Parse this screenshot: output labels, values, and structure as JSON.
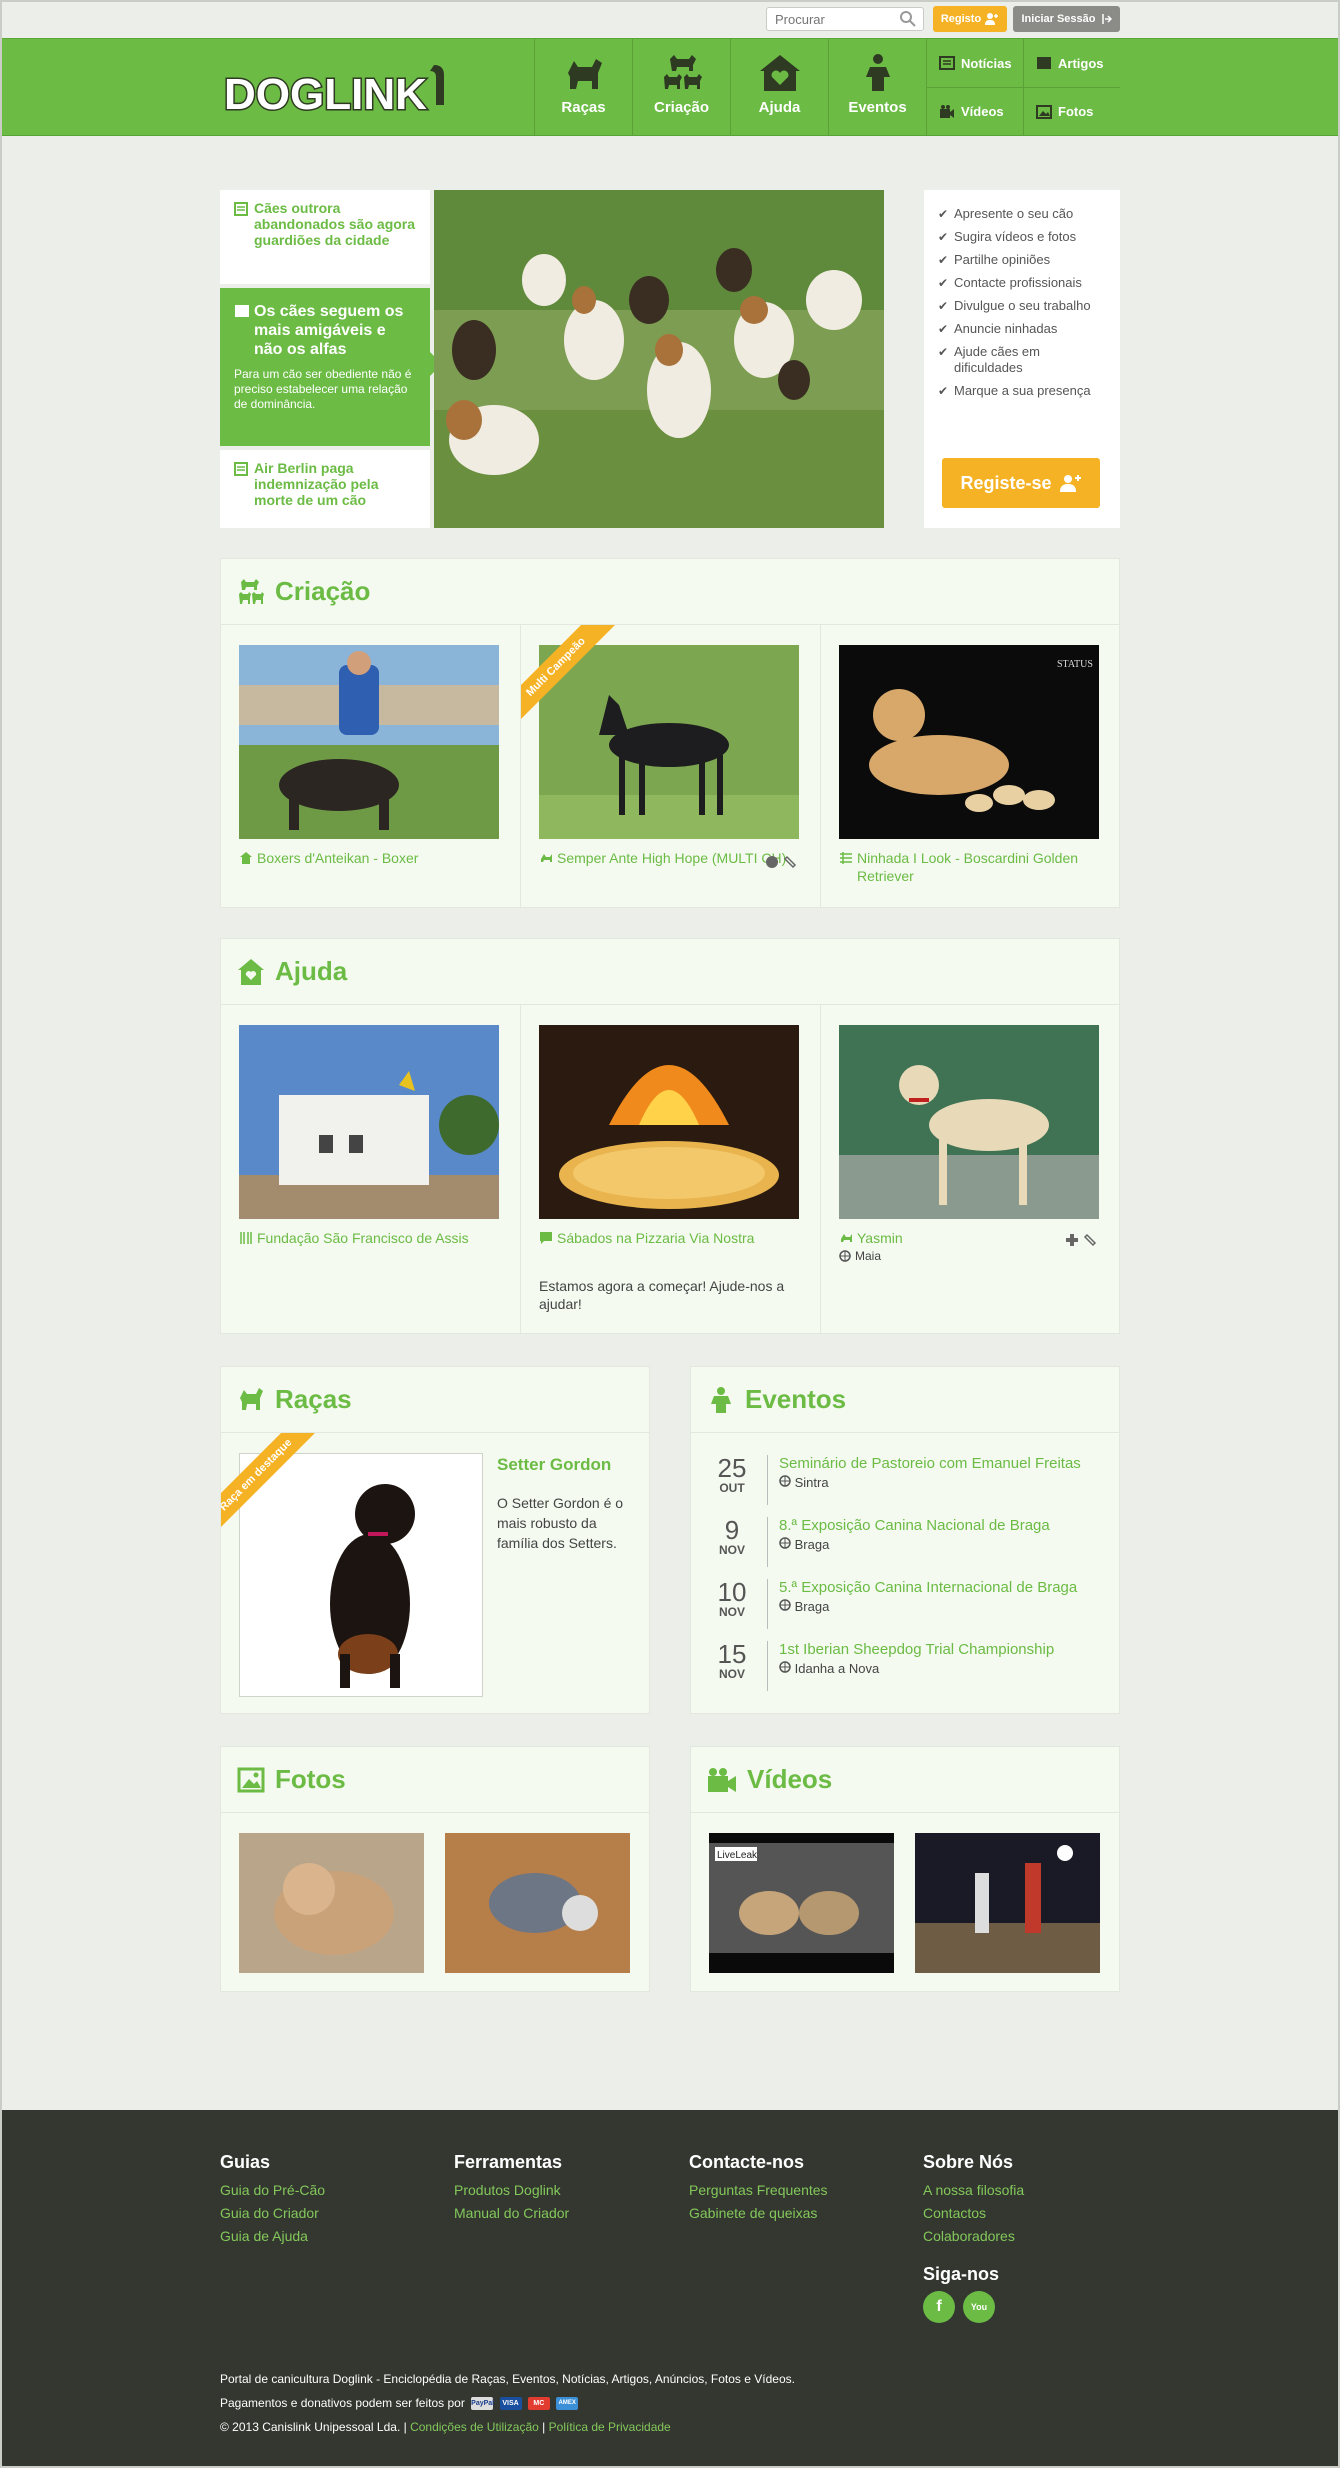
{
  "top": {
    "search_placeholder": "Procurar",
    "register_label": "Registo",
    "login_label": "Iniciar Sessão"
  },
  "brand": {
    "logo_text": "DOGLINK",
    "green": "#6bbb44",
    "yellow": "#f6b225"
  },
  "nav": {
    "big": [
      "Raças",
      "Criação",
      "Ajuda",
      "Eventos"
    ],
    "small": [
      "Notícias",
      "Artigos",
      "Vídeos",
      "Fotos"
    ]
  },
  "news": [
    {
      "title": "Cães outrora abandonados são agora guardiões da cidade"
    },
    {
      "title": "Os cães seguem os mais amigáveis e não os alfas",
      "text": "Para um cão ser obediente não é preciso estabelecer uma relação de dominância."
    },
    {
      "title": "Air Berlin paga indemnização pela morte de um cão"
    }
  ],
  "side": {
    "items": [
      "Apresente o seu cão",
      "Sugira vídeos e fotos",
      "Partilhe opiniões",
      "Contacte profissionais",
      "Divulgue o seu trabalho",
      "Anuncie ninhadas",
      "Ajude cães em dificuldades",
      "Marque a sua presença"
    ],
    "button": "Registe-se"
  },
  "criacao": {
    "title": "Criação",
    "ribbon": "Multi Campeão",
    "items": [
      "Boxers d'Anteikan - Boxer",
      "Semper Ante High Hope (MULTI CH)",
      "Ninhada I Look - Boscardini Golden Retriever"
    ],
    "watermark": "STATUS"
  },
  "ajuda": {
    "title": "Ajuda",
    "items": [
      {
        "name": "Fundação São Francisco de Assis"
      },
      {
        "name": "Sábados na Pizzaria Via Nostra",
        "text": "Estamos agora a começar! Ajude-nos a ajudar!"
      },
      {
        "name": "Yasmin",
        "place": "Maia"
      }
    ]
  },
  "racas": {
    "title": "Raças",
    "ribbon": "Raça em destaque",
    "breed": "Setter Gordon",
    "desc": "O Setter Gordon é o mais robusto da família dos Setters."
  },
  "eventos": {
    "title": "Eventos",
    "items": [
      {
        "day": "25",
        "month": "OUT",
        "title": "Seminário de Pastoreio com Emanuel Freitas",
        "place": "Sintra"
      },
      {
        "day": "9",
        "month": "NOV",
        "title": "8.ª Exposição Canina Nacional de Braga",
        "place": "Braga"
      },
      {
        "day": "10",
        "month": "NOV",
        "title": "5.ª Exposição Canina Internacional de Braga",
        "place": "Braga"
      },
      {
        "day": "15",
        "month": "NOV",
        "title": "1st Iberian Sheepdog Trial Championship",
        "place": "Idanha a Nova"
      }
    ]
  },
  "fotos": {
    "title": "Fotos"
  },
  "videos": {
    "title": "Vídeos",
    "badge": "LiveLeak"
  },
  "footer": {
    "cols": [
      {
        "title": "Guias",
        "links": [
          "Guia do Pré-Cão",
          "Guia do Criador",
          "Guia de Ajuda"
        ]
      },
      {
        "title": "Ferramentas",
        "links": [
          "Produtos Doglink",
          "Manual do Criador"
        ]
      },
      {
        "title": "Contacte-nos",
        "links": [
          "Perguntas Frequentes",
          "Gabinete de queixas"
        ]
      },
      {
        "title": "Sobre Nós",
        "links": [
          "A nossa filosofia",
          "Contactos",
          "Colaboradores"
        ]
      }
    ],
    "follow": "Siga-nos",
    "social": [
      "f",
      "You"
    ],
    "line1": "Portal de canicultura Doglink - Enciclopédia de Raças, Eventos, Notícias, Artigos, Anúncios, Fotos e Vídeos.",
    "line2": "Pagamentos e donativos podem ser feitos por",
    "payment_labels": [
      "PayPal",
      "VISA",
      "MC",
      "AMEX"
    ],
    "copyright": "© 2013 Canislink Unipessoal Lda. |",
    "terms": "Condições de Utilização",
    "sep": "|",
    "privacy": "Política de Privacidade"
  }
}
